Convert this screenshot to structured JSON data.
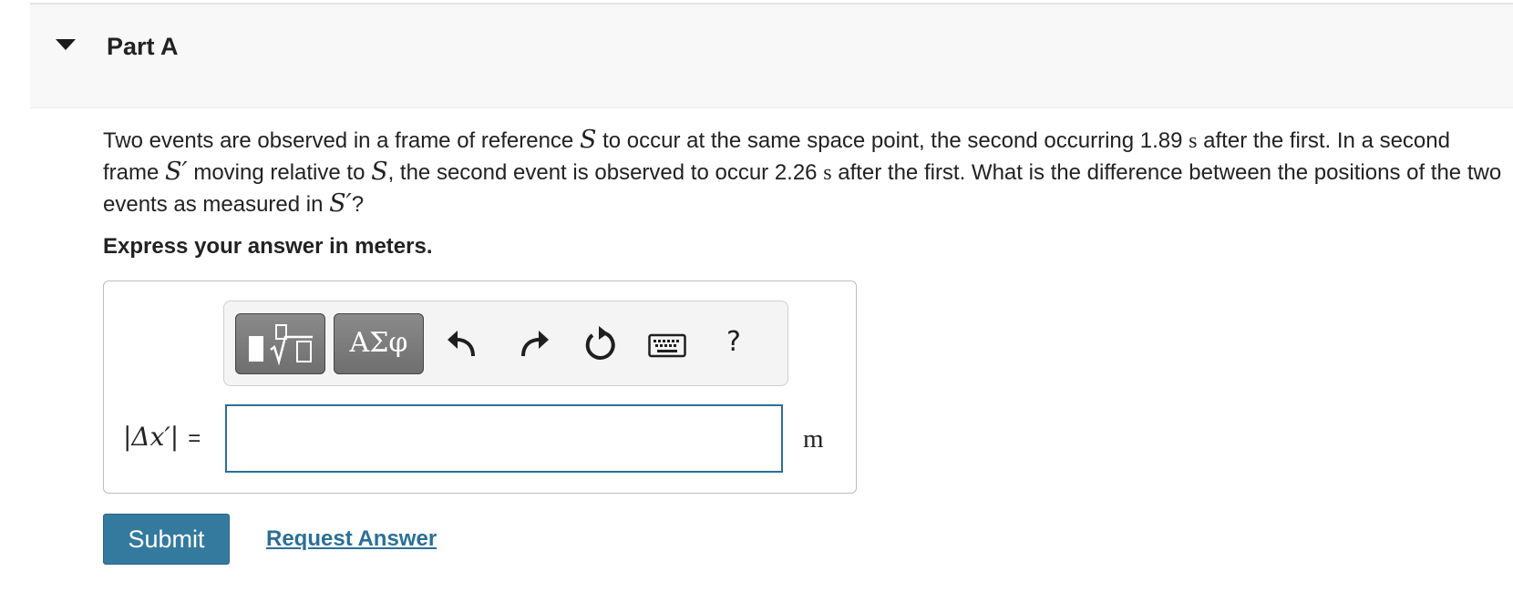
{
  "part": {
    "title": "Part A"
  },
  "question": {
    "t1": "Two events are observed in a frame of reference ",
    "S": "S",
    "t2": " to occur at the same space point, the second occurring 1.89 ",
    "unit_s": "s",
    "t3": " after the first. In a second frame ",
    "Sprime": "S′",
    "t4": " moving relative to ",
    "t5": ", the second event is observed to occur 2.26 ",
    "t6": " after the first. What is the difference between the positions of the two events as measured in ",
    "t7": "?"
  },
  "instruction": "Express your answer in meters.",
  "toolbar": {
    "greek_label": "ΑΣφ",
    "help_label": "?"
  },
  "answer": {
    "lhs": "|Δx′|",
    "equals": "=",
    "value": "",
    "unit": "m"
  },
  "actions": {
    "submit_label": "Submit",
    "request_label": "Request Answer"
  },
  "colors": {
    "accent": "#347a9f",
    "link": "#2b6f98",
    "input_border": "#2c6f95"
  }
}
